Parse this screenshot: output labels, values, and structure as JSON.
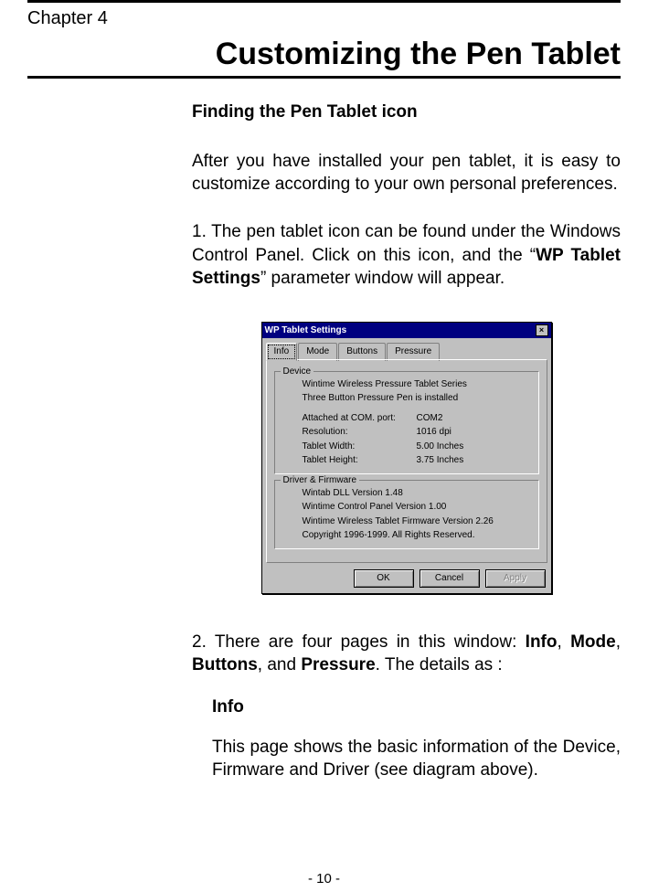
{
  "chapter_label": "Chapter 4",
  "title": "Customizing the Pen Tablet",
  "section_heading": "Finding the Pen Tablet icon",
  "intro_para": "After you have installed your pen tablet, it is easy to customize according to your own personal preferences.",
  "step1": {
    "lead": "1. The pen tablet icon can be found under the Windows Control Panel.    Click on this icon, and the “",
    "bold": "WP Tablet Settings",
    "tail": "” parameter window will appear."
  },
  "step2": {
    "lead": "2. There are four pages in this window: ",
    "b1": "Info",
    "sep1": ", ",
    "b2": "Mode",
    "sep2": ", ",
    "b3": "Buttons",
    "sep3": ", and ",
    "b4": "Pressure",
    "tail": ".  The details as :"
  },
  "info_heading": "Info",
  "info_para": "This page shows the basic information of the Device, Firmware and Driver (see diagram above).",
  "page_number": "- 10 -",
  "dialog": {
    "title": "WP Tablet Settings",
    "close": "×",
    "tabs": {
      "info": "Info",
      "mode": "Mode",
      "buttons": "Buttons",
      "pressure": "Pressure"
    },
    "device_group": "Device",
    "device_line1": "Wintime Wireless Pressure Tablet Series",
    "device_line2": "Three Button Pressure Pen is installed",
    "rows": {
      "port_label": "Attached at COM. port:",
      "port_value": "COM2",
      "res_label": "Resolution:",
      "res_value": "1016 dpi",
      "width_label": "Tablet Width:",
      "width_value": "5.00 Inches",
      "height_label": "Tablet Height:",
      "height_value": "3.75 Inches"
    },
    "driver_group": "Driver & Firmware",
    "driver_line1": "Wintab DLL Version 1.48",
    "driver_line2": "Wintime Control Panel Version 1.00",
    "driver_line3": "Wintime Wireless Tablet Firmware Version 2.26",
    "driver_line4": "Copyright 1996-1999. All Rights Reserved.",
    "buttons": {
      "ok": "OK",
      "cancel": "Cancel",
      "apply": "Apply"
    }
  }
}
